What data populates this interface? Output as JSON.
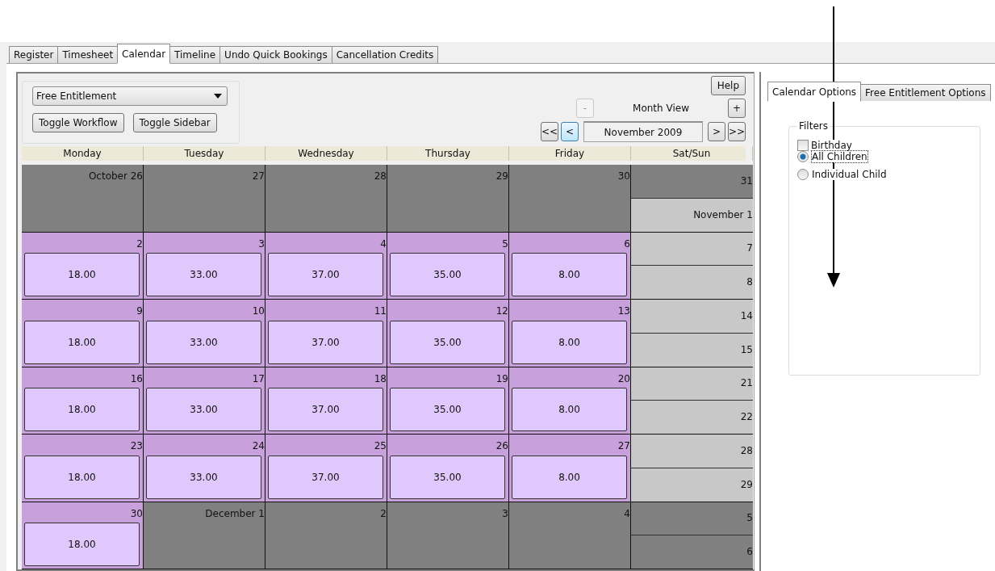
{
  "tabs": [
    {
      "label": "Register",
      "selected": false
    },
    {
      "label": "Timesheet",
      "selected": false
    },
    {
      "label": "Calendar",
      "selected": true
    },
    {
      "label": "Timeline",
      "selected": false
    },
    {
      "label": "Undo Quick Bookings",
      "selected": false
    },
    {
      "label": "Cancellation Credits",
      "selected": false
    }
  ],
  "toolbar": {
    "dropdown": "Free Entitlement",
    "buttons": [
      "Toggle Workflow",
      "Toggle Sidebar"
    ],
    "help": "Help",
    "view_label": "Month View",
    "zoom": [
      {
        "label": "-",
        "disabled": true
      },
      {
        "label": "+",
        "disabled": false
      }
    ],
    "nav_left": [
      {
        "label": "<<",
        "highlighted": false
      },
      {
        "label": "<",
        "highlighted": true
      }
    ],
    "period": "November 2009",
    "nav_right": [
      {
        "label": ">",
        "highlighted": false
      },
      {
        "label": ">>",
        "highlighted": false
      }
    ]
  },
  "columns": [
    "Monday",
    "Tuesday",
    "Wednesday",
    "Thursday",
    "Friday",
    "Sat/Sun"
  ],
  "weeks": [
    {
      "days": [
        {
          "label": "October 26",
          "in_month": false
        },
        {
          "label": "27",
          "in_month": false
        },
        {
          "label": "28",
          "in_month": false
        },
        {
          "label": "29",
          "in_month": false
        },
        {
          "label": "30",
          "in_month": false
        }
      ],
      "weekend": [
        {
          "label": "31",
          "in_month": false
        },
        {
          "label": "November 1",
          "in_month": true
        }
      ]
    },
    {
      "days": [
        {
          "label": "2",
          "in_month": true,
          "amount": "18.00"
        },
        {
          "label": "3",
          "in_month": true,
          "amount": "33.00"
        },
        {
          "label": "4",
          "in_month": true,
          "amount": "37.00"
        },
        {
          "label": "5",
          "in_month": true,
          "amount": "35.00"
        },
        {
          "label": "6",
          "in_month": true,
          "amount": "8.00"
        }
      ],
      "weekend": [
        {
          "label": "7",
          "in_month": true
        },
        {
          "label": "8",
          "in_month": true
        }
      ]
    },
    {
      "days": [
        {
          "label": "9",
          "in_month": true,
          "amount": "18.00"
        },
        {
          "label": "10",
          "in_month": true,
          "amount": "33.00"
        },
        {
          "label": "11",
          "in_month": true,
          "amount": "37.00"
        },
        {
          "label": "12",
          "in_month": true,
          "amount": "35.00"
        },
        {
          "label": "13",
          "in_month": true,
          "amount": "8.00"
        }
      ],
      "weekend": [
        {
          "label": "14",
          "in_month": true
        },
        {
          "label": "15",
          "in_month": true
        }
      ]
    },
    {
      "days": [
        {
          "label": "16",
          "in_month": true,
          "amount": "18.00"
        },
        {
          "label": "17",
          "in_month": true,
          "amount": "33.00"
        },
        {
          "label": "18",
          "in_month": true,
          "amount": "37.00"
        },
        {
          "label": "19",
          "in_month": true,
          "amount": "35.00"
        },
        {
          "label": "20",
          "in_month": true,
          "amount": "8.00"
        }
      ],
      "weekend": [
        {
          "label": "21",
          "in_month": true
        },
        {
          "label": "22",
          "in_month": true
        }
      ]
    },
    {
      "days": [
        {
          "label": "23",
          "in_month": true,
          "amount": "18.00"
        },
        {
          "label": "24",
          "in_month": true,
          "amount": "33.00"
        },
        {
          "label": "25",
          "in_month": true,
          "amount": "37.00"
        },
        {
          "label": "26",
          "in_month": true,
          "amount": "35.00"
        },
        {
          "label": "27",
          "in_month": true,
          "amount": "8.00"
        }
      ],
      "weekend": [
        {
          "label": "28",
          "in_month": true
        },
        {
          "label": "29",
          "in_month": true
        }
      ]
    },
    {
      "days": [
        {
          "label": "30",
          "in_month": true,
          "amount": "18.00"
        },
        {
          "label": "December 1",
          "in_month": false
        },
        {
          "label": "2",
          "in_month": false
        },
        {
          "label": "3",
          "in_month": false
        },
        {
          "label": "4",
          "in_month": false
        }
      ],
      "weekend": [
        {
          "label": "5",
          "in_month": false
        },
        {
          "label": "6",
          "in_month": false
        }
      ]
    }
  ],
  "sidebar": {
    "tabs": [
      {
        "label": "Calendar Options",
        "selected": true
      },
      {
        "label": "Free Entitlement Options",
        "selected": false
      }
    ],
    "group_title": "Filters",
    "checkbox": {
      "label": "Birthday",
      "checked": false
    },
    "radios": [
      {
        "label": "All Children",
        "selected": true,
        "focused": true
      },
      {
        "label": "Individual Child",
        "selected": false,
        "focused": false
      }
    ]
  }
}
